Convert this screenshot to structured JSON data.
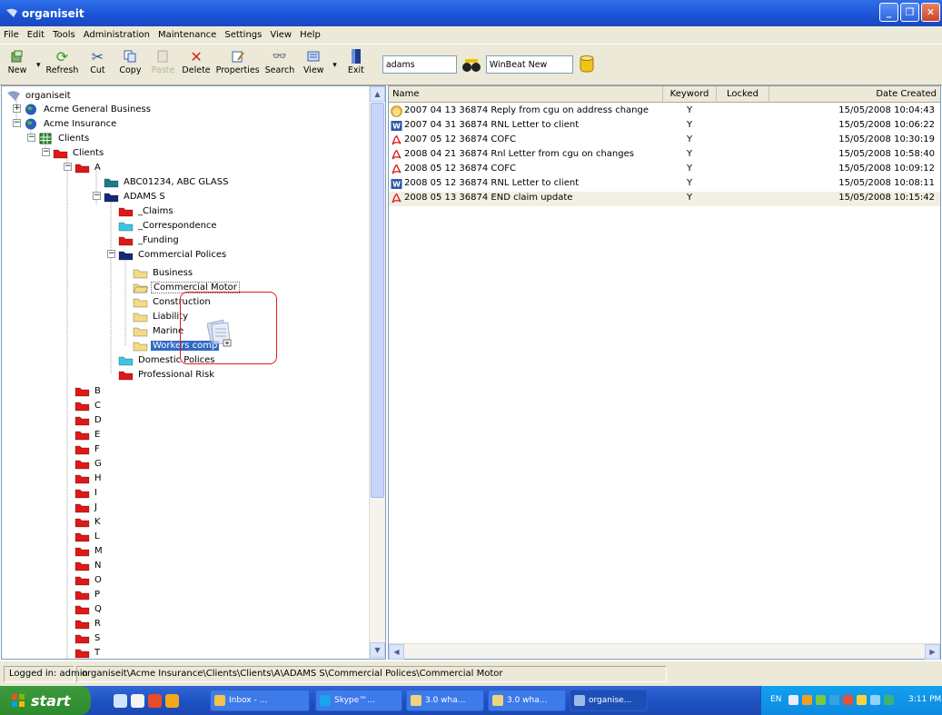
{
  "window": {
    "title": "organiseit"
  },
  "menu": [
    "File",
    "Edit",
    "Tools",
    "Administration",
    "Maintenance",
    "Settings",
    "View",
    "Help"
  ],
  "toolbar": {
    "new_label": "New",
    "refresh_label": "Refresh",
    "cut_label": "Cut",
    "copy_label": "Copy",
    "paste_label": "Paste",
    "delete_label": "Delete",
    "properties_label": "Properties",
    "search_label": "Search",
    "view_label": "View",
    "exit_label": "Exit",
    "search_value": "adams",
    "profile_value": "WinBeat New"
  },
  "tree": {
    "root": "organiseit",
    "acme_general": "Acme General Business",
    "acme_insurance": "Acme Insurance",
    "clients_group": "Clients",
    "clients": "Clients",
    "a": "A",
    "abc": "ABC01234, ABC GLASS",
    "adams": "ADAMS S",
    "claims": "_Claims",
    "correspondence": "_Correspondence",
    "funding": "_Funding",
    "commercial": "Commercial Polices",
    "business": "Business",
    "commercial_motor": "Commercial Motor",
    "construction": "Construction",
    "liability": "Liability",
    "marine": "Marine",
    "workers": "Workers comp",
    "domestic": "Domestic Polices",
    "professional": "Professional Risk",
    "letters": [
      "B",
      "C",
      "D",
      "E",
      "F",
      "G",
      "H",
      "I",
      "J",
      "K",
      "L",
      "M",
      "N",
      "O",
      "P",
      "Q",
      "R",
      "S",
      "T"
    ]
  },
  "list": {
    "headers": {
      "name": "Name",
      "keyword": "Keyword",
      "locked": "Locked",
      "date": "Date Created"
    },
    "rows": [
      {
        "name": "2007 04 13 36874 Reply from cgu on address change",
        "keyword": "Y",
        "date": "15/05/2008 10:04:43",
        "icon": "email-icon"
      },
      {
        "name": "2007 04 31 36874 RNL Letter to client",
        "keyword": "Y",
        "date": "15/05/2008 10:06:22",
        "icon": "word-icon"
      },
      {
        "name": "2007 05 12 36874 COFC",
        "keyword": "Y",
        "date": "15/05/2008 10:30:19",
        "icon": "pdf-icon"
      },
      {
        "name": "2008 04 21 36874 Rnl Letter from cgu on changes",
        "keyword": "Y",
        "date": "15/05/2008 10:58:40",
        "icon": "pdf-icon"
      },
      {
        "name": "2008 05 12 36874 COFC",
        "keyword": "Y",
        "date": "15/05/2008 10:09:12",
        "icon": "pdf-icon"
      },
      {
        "name": "2008 05 12 36874 RNL Letter to client",
        "keyword": "Y",
        "date": "15/05/2008 10:08:11",
        "icon": "word-icon"
      },
      {
        "name": "2008 05 13 36874 END claim update",
        "keyword": "Y",
        "date": "15/05/2008 10:15:42",
        "icon": "pdf-icon"
      }
    ]
  },
  "status": {
    "user": "Logged in: admin",
    "path": "organiseit\\Acme Insurance\\Clients\\Clients\\A\\ADAMS S\\Commercial Polices\\Commercial Motor"
  },
  "taskbar": {
    "start": "start",
    "tasks": [
      "Inbox - ...",
      "Skype™...",
      "3.0 wha...",
      "3.0 wha...",
      "organise..."
    ],
    "lang": "EN",
    "clock": "3:11 PM"
  },
  "colors": {
    "red_folder": "#e01818",
    "navy_folder": "#14287a",
    "cyan_folder": "#3bc6e8",
    "yellow_folder": "#f3dc84",
    "teal_folder": "#1c7a88",
    "selection": "#316ac5",
    "highlight_box": "#e01c1c"
  }
}
